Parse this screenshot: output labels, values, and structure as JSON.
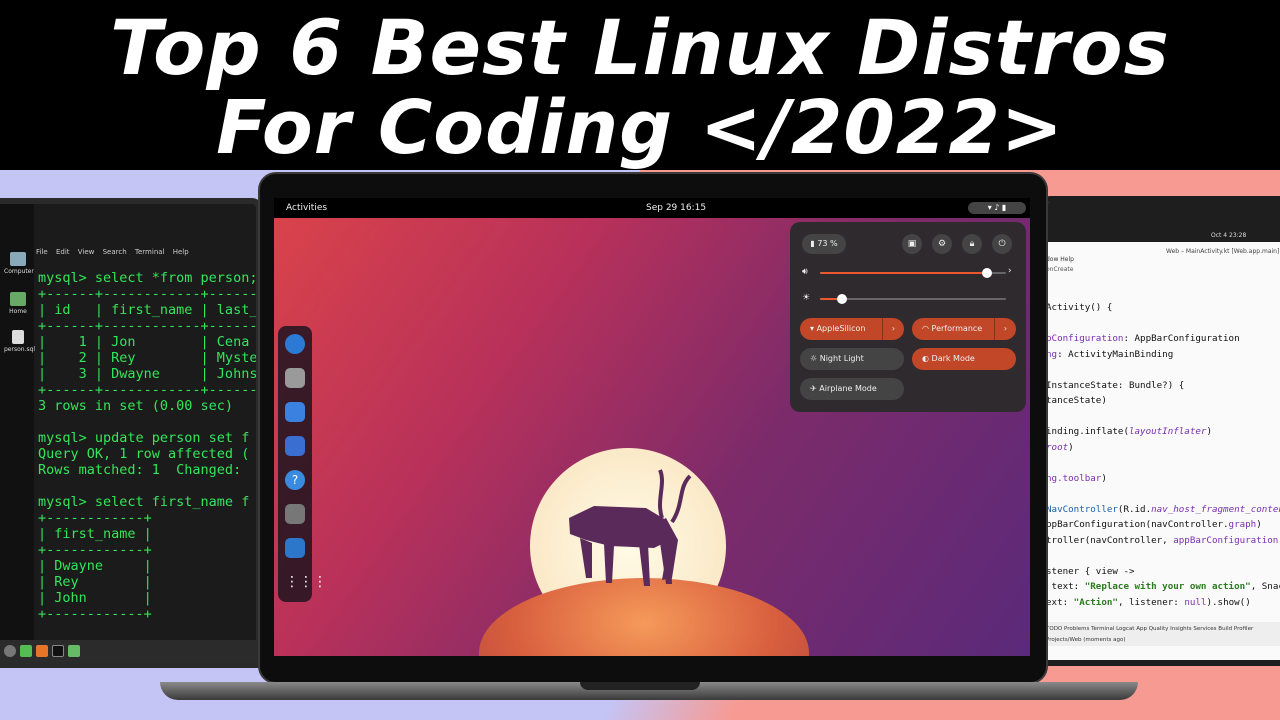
{
  "title": {
    "line1": "Top 6 Best Linux Distros",
    "line2": "For Coding </2022>"
  },
  "left_desktop": {
    "icons": [
      "Computer",
      "Home",
      "person.sql"
    ],
    "menu": [
      "File",
      "Edit",
      "View",
      "Search",
      "Terminal",
      "Help"
    ],
    "terminal_lines": [
      "mysql> select *from person;",
      "+------+------------+------",
      "| id   | first_name | last_",
      "+------+------------+------",
      "|    1 | Jon        | Cena",
      "|    2 | Rey        | Myste",
      "|    3 | Dwayne     | Johns",
      "+------+------------+------",
      "3 rows in set (0.00 sec)",
      "",
      "mysql> update person set f",
      "Query OK, 1 row affected (",
      "Rows matched: 1  Changed:",
      "",
      "mysql> select first_name f",
      "+------------+",
      "| first_name |",
      "+------------+",
      "| Dwayne     |",
      "| Rey        |",
      "| John       |",
      "+------------+"
    ]
  },
  "ide": {
    "clock": "Oct 4  23:28",
    "window_title": "Web – MainActivity.kt [Web.app.main]",
    "menu": "dow  Help",
    "crumb": "onCreate",
    "status_tabs": "TODO   Problems   Terminal   Logcat   App Quality Insights   Services   Build   Profiler",
    "status_path": "Projects/Web (moments ago)"
  },
  "gnome": {
    "activities": "Activities",
    "clock": "Sep 29  16:15",
    "battery": "73 %",
    "tiles": {
      "wifi": "AppleSilicon",
      "power": "Performance",
      "night": "Night Light",
      "dark": "Dark Mode",
      "airplane": "Airplane Mode"
    },
    "volume_level": 0.9,
    "brightness_level": 0.12
  },
  "colors": {
    "accent": "#c24628",
    "terminal_text": "#33e55a",
    "left_bg": "#c4c4f5",
    "right_bg": "#f79a92"
  }
}
